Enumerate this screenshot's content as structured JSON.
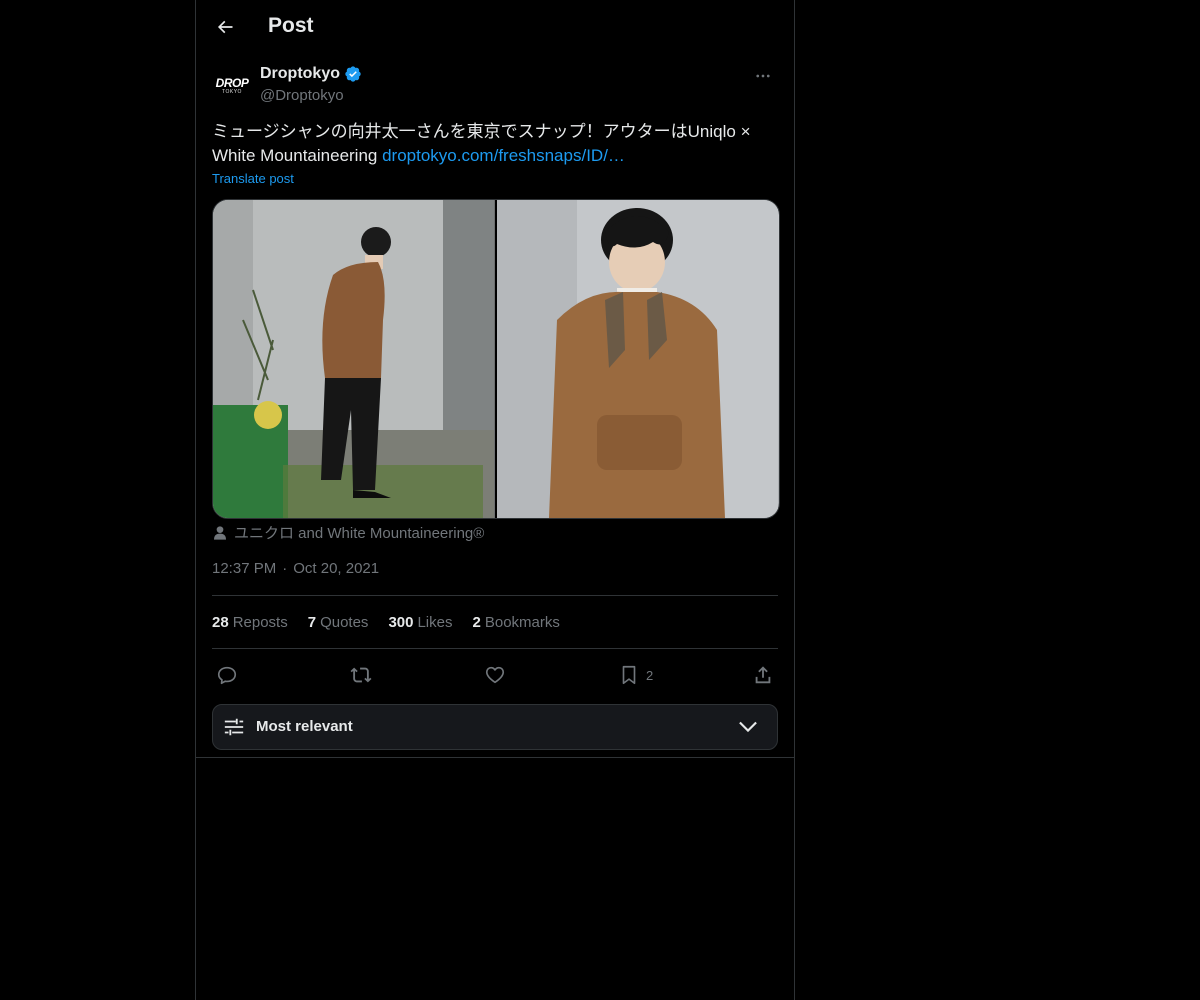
{
  "header": {
    "title": "Post"
  },
  "author": {
    "display_name": "Droptokyo",
    "handle": "@Droptokyo",
    "avatar_main": "DROP",
    "avatar_sub": "TOKYO",
    "verified_color": "#1d9bf0"
  },
  "post": {
    "text_line1": "ミュージシャンの向井太一さんを東京でスナップ！アウターはUniqlo ×",
    "text_line2_prefix": "White Mountaineering ",
    "link": "droptokyo.com/freshsnaps/ID/…",
    "translate_label": "Translate post",
    "tags": "ユニクロ and White Mountaineering®",
    "time": "12:37 PM",
    "separator": "·",
    "date": "Oct 20, 2021"
  },
  "stats": {
    "reposts_count": "28",
    "reposts_label": "Reposts",
    "quotes_count": "7",
    "quotes_label": "Quotes",
    "likes_count": "300",
    "likes_label": "Likes",
    "bookmarks_count": "2",
    "bookmarks_label": "Bookmarks"
  },
  "actions": {
    "bookmark_count": "2"
  },
  "replies": {
    "sort_label": "Most relevant"
  },
  "colors": {
    "accent": "#1d9bf0",
    "muted": "#71767b",
    "text": "#e7e9ea",
    "border": "#2f3336"
  }
}
